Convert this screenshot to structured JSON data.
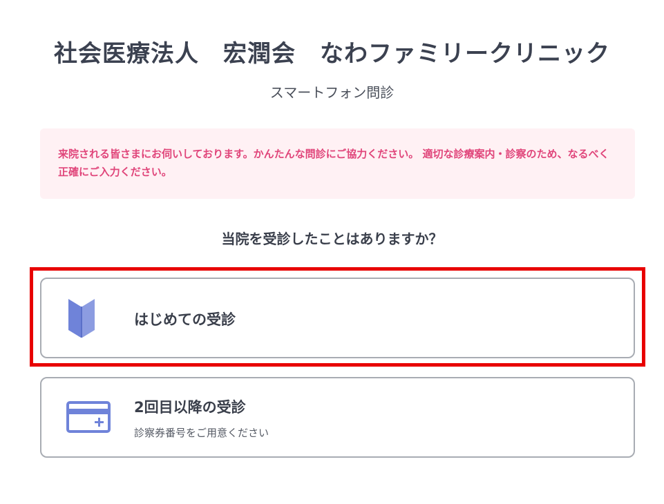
{
  "header": {
    "clinic_name": "社会医療法人　宏潤会　なわファミリークリニック",
    "subtitle": "スマートフォン問診"
  },
  "notice": {
    "text": "来院される皆さまにお伺いしております。かんたんな問診にご協力ください。 適切な診療案内・診察のため、なるべく正確にご入力ください。"
  },
  "question": {
    "text": "当院を受診したことはありますか？"
  },
  "options": [
    {
      "label": "はじめての受診",
      "icon": "beginner-mark-icon",
      "highlighted": true
    },
    {
      "label": "2回目以降の受診",
      "sublabel": "診察券番号をご用意ください",
      "icon": "card-icon"
    }
  ],
  "colors": {
    "accent_icon": "#6f83d9",
    "notice_text": "#e0457a",
    "notice_bg": "#fff1f4",
    "highlight_frame": "#e80000",
    "card_border": "#a8acb3"
  }
}
